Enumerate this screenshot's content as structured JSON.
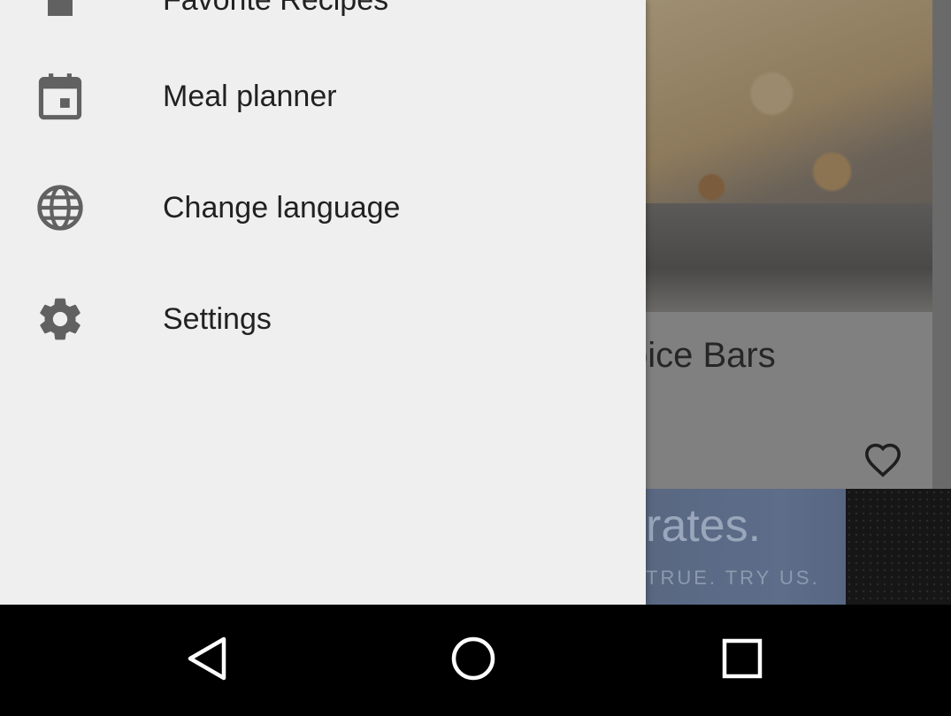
{
  "background": {
    "card_title": "pice Bars",
    "ad_headline": "rates.",
    "ad_tagline": "TRUE. TRY US.",
    "favorite_icon": "heart-outline-icon"
  },
  "drawer": {
    "items": [
      {
        "label": "Favorite Recipes",
        "icon": "bookmark-icon"
      },
      {
        "label": "Meal planner",
        "icon": "calendar-icon"
      },
      {
        "label": "Change language",
        "icon": "globe-icon"
      },
      {
        "label": "Settings",
        "icon": "gear-icon"
      }
    ]
  },
  "navbar": {
    "back_icon": "back-triangle-icon",
    "home_icon": "home-circle-icon",
    "recents_icon": "recents-square-icon"
  },
  "colors": {
    "drawer_bg": "#efefef",
    "icon": "#616161",
    "text": "#212121",
    "scrim": "#6f6f6f",
    "navbar_bg": "#000000"
  }
}
